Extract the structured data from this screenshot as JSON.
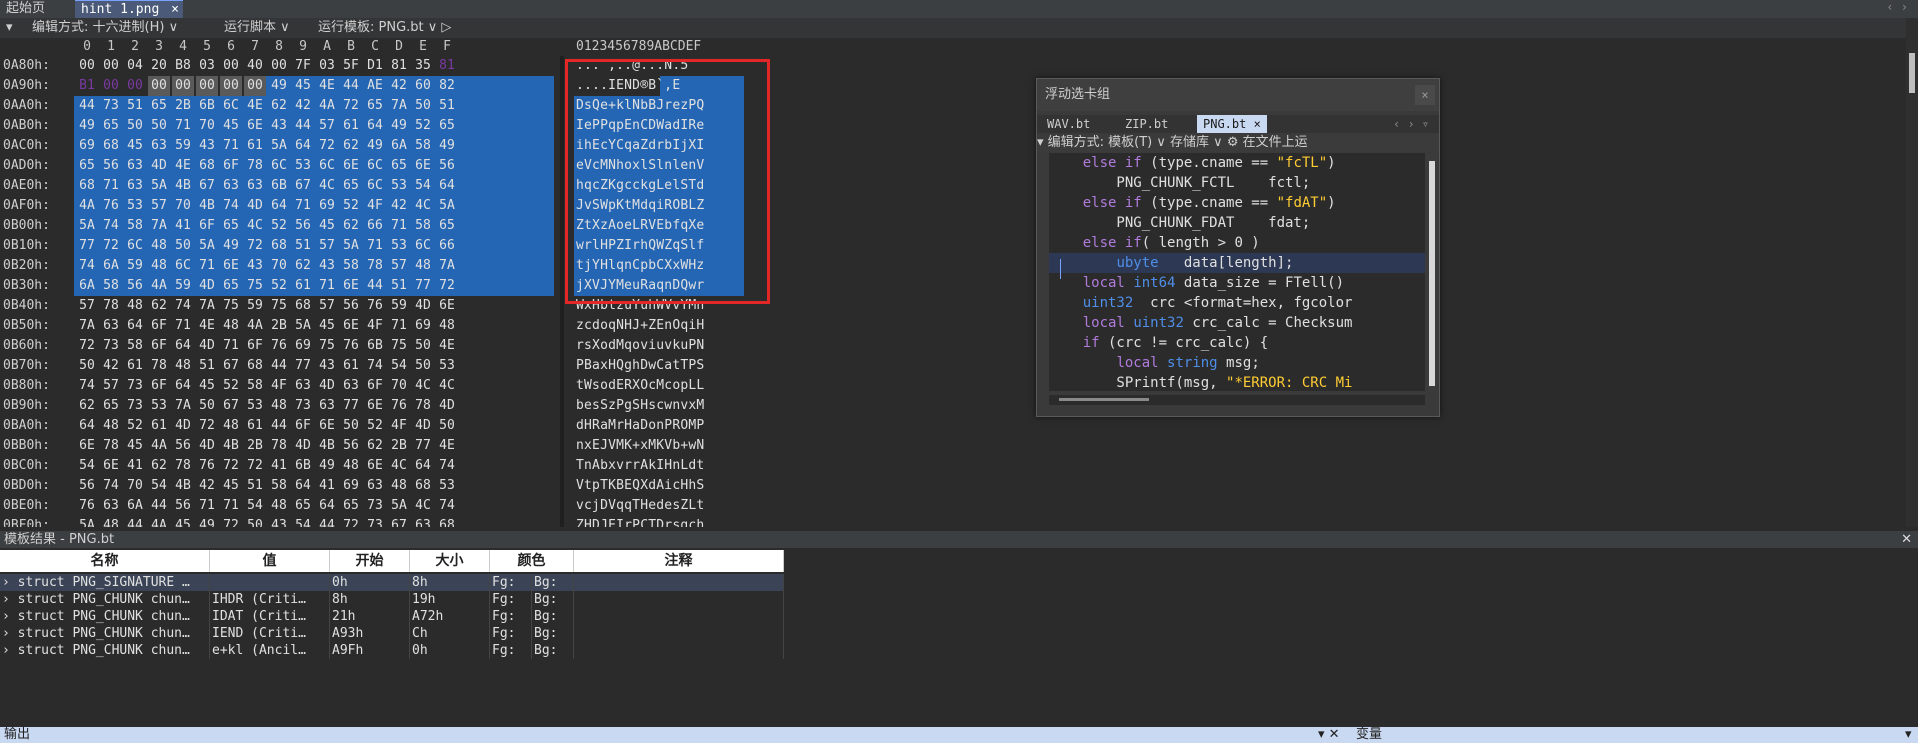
{
  "tabs": {
    "start": "起始页",
    "file": "hint 1.png",
    "close": "×",
    "arrows": "‹ ›"
  },
  "toolbar": {
    "collapse": "▾",
    "edit_mode": "编辑方式: 十六进制(H) ∨",
    "run_script": "运行脚本 ∨",
    "run_template": "运行模板: PNG.bt ∨ ▷"
  },
  "hex": {
    "col_headers": [
      "0",
      "1",
      "2",
      "3",
      "4",
      "5",
      "6",
      "7",
      "8",
      "9",
      "A",
      "B",
      "C",
      "D",
      "E",
      "F"
    ],
    "ascii_header": "0123456789ABCDEF",
    "rows": [
      {
        "addr": "0A80h:",
        "bytes": [
          "00",
          "00",
          "04",
          "20",
          "B8",
          "03",
          "00",
          "40",
          "00",
          "7F",
          "03",
          "5F",
          "D1",
          "81",
          "35",
          "81"
        ],
        "ascii": "... ,..@...N.5 "
      },
      {
        "addr": "0A90h:",
        "bytes": [
          "B1",
          "00",
          "00",
          "00",
          "00",
          "00",
          "00",
          "00",
          "49",
          "45",
          "4E",
          "44",
          "AE",
          "42",
          "60",
          "82"
        ],
        "ascii": "  ....IEND®B`,E"
      },
      {
        "addr": "0AA0h:",
        "bytes": [
          "44",
          "73",
          "51",
          "65",
          "2B",
          "6B",
          "6C",
          "4E",
          "62",
          "42",
          "4A",
          "72",
          "65",
          "7A",
          "50",
          "51"
        ],
        "ascii": "DsQe+klNbBJrezPQ"
      },
      {
        "addr": "0AB0h:",
        "bytes": [
          "49",
          "65",
          "50",
          "50",
          "71",
          "70",
          "45",
          "6E",
          "43",
          "44",
          "57",
          "61",
          "64",
          "49",
          "52",
          "65"
        ],
        "ascii": "IePPqpEnCDWadIRe"
      },
      {
        "addr": "0AC0h:",
        "bytes": [
          "69",
          "68",
          "45",
          "63",
          "59",
          "43",
          "71",
          "61",
          "5A",
          "64",
          "72",
          "62",
          "49",
          "6A",
          "58",
          "49"
        ],
        "ascii": "ihEcYCqaZdrbIjXI"
      },
      {
        "addr": "0AD0h:",
        "bytes": [
          "65",
          "56",
          "63",
          "4D",
          "4E",
          "68",
          "6F",
          "78",
          "6C",
          "53",
          "6C",
          "6E",
          "6C",
          "65",
          "6E",
          "56"
        ],
        "ascii": "eVcMNhoxlSlnlenV"
      },
      {
        "addr": "0AE0h:",
        "bytes": [
          "68",
          "71",
          "63",
          "5A",
          "4B",
          "67",
          "63",
          "63",
          "6B",
          "67",
          "4C",
          "65",
          "6C",
          "53",
          "54",
          "64"
        ],
        "ascii": "hqcZKgcckgLelSTd"
      },
      {
        "addr": "0AF0h:",
        "bytes": [
          "4A",
          "76",
          "53",
          "57",
          "70",
          "4B",
          "74",
          "4D",
          "64",
          "71",
          "69",
          "52",
          "4F",
          "42",
          "4C",
          "5A"
        ],
        "ascii": "JvSWpKtMdqiROBLZ"
      },
      {
        "addr": "0B00h:",
        "bytes": [
          "5A",
          "74",
          "58",
          "7A",
          "41",
          "6F",
          "65",
          "4C",
          "52",
          "56",
          "45",
          "62",
          "66",
          "71",
          "58",
          "65"
        ],
        "ascii": "ZtXzAoeLRVEbfqXe"
      },
      {
        "addr": "0B10h:",
        "bytes": [
          "77",
          "72",
          "6C",
          "48",
          "50",
          "5A",
          "49",
          "72",
          "68",
          "51",
          "57",
          "5A",
          "71",
          "53",
          "6C",
          "66"
        ],
        "ascii": "wrlHPZIrhQWZqSlf"
      },
      {
        "addr": "0B20h:",
        "bytes": [
          "74",
          "6A",
          "59",
          "48",
          "6C",
          "71",
          "6E",
          "43",
          "70",
          "62",
          "43",
          "58",
          "78",
          "57",
          "48",
          "7A"
        ],
        "ascii": "tjYHlqnCpbCXxWHz"
      },
      {
        "addr": "0B30h:",
        "bytes": [
          "6A",
          "58",
          "56",
          "4A",
          "59",
          "4D",
          "65",
          "75",
          "52",
          "61",
          "71",
          "6E",
          "44",
          "51",
          "77",
          "72"
        ],
        "ascii": "jXVJYMeuRaqnDQwr"
      },
      {
        "addr": "0B40h:",
        "bytes": [
          "57",
          "78",
          "48",
          "62",
          "74",
          "7A",
          "75",
          "59",
          "75",
          "68",
          "57",
          "56",
          "76",
          "59",
          "4D",
          "6E"
        ],
        "ascii": "WxHbtzuYuhWVvYMn"
      },
      {
        "addr": "0B50h:",
        "bytes": [
          "7A",
          "63",
          "64",
          "6F",
          "71",
          "4E",
          "48",
          "4A",
          "2B",
          "5A",
          "45",
          "6E",
          "4F",
          "71",
          "69",
          "48"
        ],
        "ascii": "zcdoqNHJ+ZEnOqiH"
      },
      {
        "addr": "0B60h:",
        "bytes": [
          "72",
          "73",
          "58",
          "6F",
          "64",
          "4D",
          "71",
          "6F",
          "76",
          "69",
          "75",
          "76",
          "6B",
          "75",
          "50",
          "4E"
        ],
        "ascii": "rsXodMqoviuvkuPN"
      },
      {
        "addr": "0B70h:",
        "bytes": [
          "50",
          "42",
          "61",
          "78",
          "48",
          "51",
          "67",
          "68",
          "44",
          "77",
          "43",
          "61",
          "74",
          "54",
          "50",
          "53"
        ],
        "ascii": "PBaxHQghDwCatTPS"
      },
      {
        "addr": "0B80h:",
        "bytes": [
          "74",
          "57",
          "73",
          "6F",
          "64",
          "45",
          "52",
          "58",
          "4F",
          "63",
          "4D",
          "63",
          "6F",
          "70",
          "4C",
          "4C"
        ],
        "ascii": "tWsodERXOcMcopLL"
      },
      {
        "addr": "0B90h:",
        "bytes": [
          "62",
          "65",
          "73",
          "53",
          "7A",
          "50",
          "67",
          "53",
          "48",
          "73",
          "63",
          "77",
          "6E",
          "76",
          "78",
          "4D"
        ],
        "ascii": "besSzPgSHscwnvxM"
      },
      {
        "addr": "0BA0h:",
        "bytes": [
          "64",
          "48",
          "52",
          "61",
          "4D",
          "72",
          "48",
          "61",
          "44",
          "6F",
          "6E",
          "50",
          "52",
          "4F",
          "4D",
          "50"
        ],
        "ascii": "dHRaMrHaDonPROMP"
      },
      {
        "addr": "0BB0h:",
        "bytes": [
          "6E",
          "78",
          "45",
          "4A",
          "56",
          "4D",
          "4B",
          "2B",
          "78",
          "4D",
          "4B",
          "56",
          "62",
          "2B",
          "77",
          "4E"
        ],
        "ascii": "nxEJVMK+xMKVb+wN"
      },
      {
        "addr": "0BC0h:",
        "bytes": [
          "54",
          "6E",
          "41",
          "62",
          "78",
          "76",
          "72",
          "72",
          "41",
          "6B",
          "49",
          "48",
          "6E",
          "4C",
          "64",
          "74"
        ],
        "ascii": "TnAbxvrrAkIHnLdt"
      },
      {
        "addr": "0BD0h:",
        "bytes": [
          "56",
          "74",
          "70",
          "54",
          "4B",
          "42",
          "45",
          "51",
          "58",
          "64",
          "41",
          "69",
          "63",
          "48",
          "68",
          "53"
        ],
        "ascii": "VtpTKBEQXdAicHhS"
      },
      {
        "addr": "0BE0h:",
        "bytes": [
          "76",
          "63",
          "6A",
          "44",
          "56",
          "71",
          "71",
          "54",
          "48",
          "65",
          "64",
          "65",
          "73",
          "5A",
          "4C",
          "74"
        ],
        "ascii": "vcjDVqqTHedesZLt"
      },
      {
        "addr": "0BF0h:",
        "bytes": [
          "5A",
          "48",
          "44",
          "4A",
          "45",
          "49",
          "72",
          "50",
          "43",
          "54",
          "44",
          "72",
          "73",
          "67",
          "63",
          "68"
        ],
        "ascii": "ZHDJEIrPCTDrsgch"
      }
    ]
  },
  "floating": {
    "title": "浮动选卡组",
    "close": "×",
    "tabs": [
      "WAV.bt",
      "ZIP.bt",
      "PNG.bt ×"
    ],
    "tab_arrows": "‹ › ▿",
    "toolbar": "▾  编辑方式: 模板(T) ∨   存储库 ∨  ⚙   在文件上运",
    "code_lines": [
      [
        {
          "t": "    ",
          "c": ""
        },
        {
          "t": "else if",
          "c": "kw"
        },
        {
          "t": " (type.cname == ",
          "c": ""
        },
        {
          "t": "\"fcTL\"",
          "c": "st"
        },
        {
          "t": ")",
          "c": ""
        }
      ],
      [
        {
          "t": "        PNG_CHUNK_FCTL    fctl;",
          "c": ""
        }
      ],
      [
        {
          "t": "    ",
          "c": ""
        },
        {
          "t": "else if",
          "c": "kw"
        },
        {
          "t": " (type.cname == ",
          "c": ""
        },
        {
          "t": "\"fdAT\"",
          "c": "st"
        },
        {
          "t": ")",
          "c": ""
        }
      ],
      [
        {
          "t": "        PNG_CHUNK_FDAT    fdat;",
          "c": ""
        }
      ],
      [
        {
          "t": "    ",
          "c": ""
        },
        {
          "t": "else if",
          "c": "kw"
        },
        {
          "t": "( length > 0 )",
          "c": ""
        }
      ],
      [
        {
          "t": "        ",
          "c": ""
        },
        {
          "t": "ubyte",
          "c": "ty"
        },
        {
          "t": "   data[length];",
          "c": ""
        }
      ],
      [
        {
          "t": "    ",
          "c": ""
        },
        {
          "t": "local",
          "c": "kw"
        },
        {
          "t": " ",
          "c": ""
        },
        {
          "t": "int64",
          "c": "ty"
        },
        {
          "t": " data_size = FTell()",
          "c": ""
        }
      ],
      [
        {
          "t": "    ",
          "c": ""
        },
        {
          "t": "uint32",
          "c": "ty"
        },
        {
          "t": "  crc <format=hex, fgcolor",
          "c": ""
        }
      ],
      [
        {
          "t": "    ",
          "c": ""
        },
        {
          "t": "local",
          "c": "kw"
        },
        {
          "t": " ",
          "c": ""
        },
        {
          "t": "uint32",
          "c": "ty"
        },
        {
          "t": " crc_calc = Checksum",
          "c": ""
        }
      ],
      [
        {
          "t": "    ",
          "c": ""
        },
        {
          "t": "if",
          "c": "kw"
        },
        {
          "t": " (crc != crc_calc) {",
          "c": ""
        }
      ],
      [
        {
          "t": "        ",
          "c": ""
        },
        {
          "t": "local",
          "c": "kw"
        },
        {
          "t": " ",
          "c": ""
        },
        {
          "t": "string",
          "c": "ty"
        },
        {
          "t": " msg;",
          "c": ""
        }
      ],
      [
        {
          "t": "        SPrintf(msg, ",
          "c": ""
        },
        {
          "t": "\"*ERROR: CRC Mi",
          "c": "st"
        }
      ]
    ]
  },
  "results": {
    "title": "模板结果 - PNG.bt",
    "close": "✕",
    "headers": [
      "名称",
      "值",
      "开始",
      "大小",
      "颜色",
      "注释"
    ],
    "rows": [
      {
        "name": "› struct PNG_SIGNATURE …",
        "value": "",
        "start": "0h",
        "size": "8h",
        "fg": "Fg:",
        "bg": "Bg:"
      },
      {
        "name": "› struct PNG_CHUNK chun…",
        "value": "IHDR  (Criti…",
        "start": "8h",
        "size": "19h",
        "fg": "Fg:",
        "bg": "Bg:"
      },
      {
        "name": "› struct PNG_CHUNK chun…",
        "value": "IDAT  (Criti…",
        "start": "21h",
        "size": "A72h",
        "fg": "Fg:",
        "bg": "Bg:"
      },
      {
        "name": "› struct PNG_CHUNK chun…",
        "value": "IEND  (Criti…",
        "start": "A93h",
        "size": "Ch",
        "fg": "Fg:",
        "bg": "Bg:"
      },
      {
        "name": "› struct PNG_CHUNK chun…",
        "value": "e+kl  (Ancil…",
        "start": "A9Fh",
        "size": "0h",
        "fg": "Fg:",
        "bg": "Bg:"
      }
    ]
  },
  "bottom": {
    "output": "输出",
    "controls": "▾ ✕",
    "vars": "变量",
    "vars_arrow": "▾"
  }
}
